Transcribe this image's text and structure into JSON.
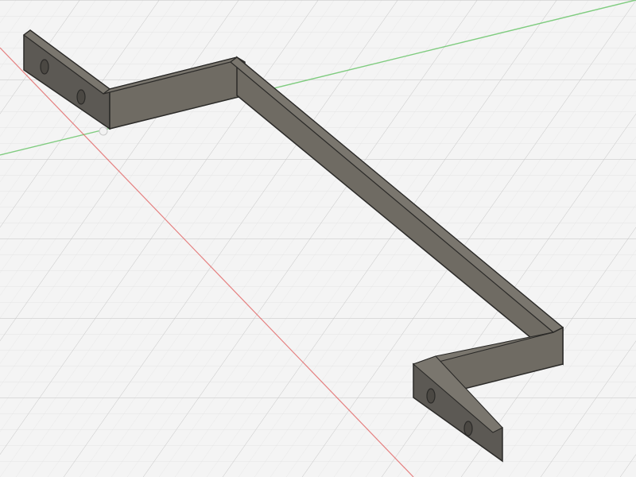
{
  "app": {
    "view": "3d-model-viewport",
    "projection": "isometric"
  },
  "viewport": {
    "background_color": "#f4f4f4",
    "grid_minor_color": "#dedede",
    "grid_major_color": "#c6c6c6",
    "x_axis_color": "#e05a5a",
    "y_axis_color": "#74c874",
    "origin_marker": "origin-icon"
  },
  "model": {
    "name": "bracket",
    "type": "bent-flat-bar-with-mounting-tabs",
    "material_colors": {
      "top_face": "#6f6b63",
      "side_face": "#5c5954",
      "inner_face": "#7a766e",
      "edge": "#2b2a28",
      "hole": "#4b4843"
    },
    "mounting_tabs": [
      {
        "name": "left-tab",
        "holes": 2
      },
      {
        "name": "right-tab",
        "holes": 2
      }
    ]
  }
}
